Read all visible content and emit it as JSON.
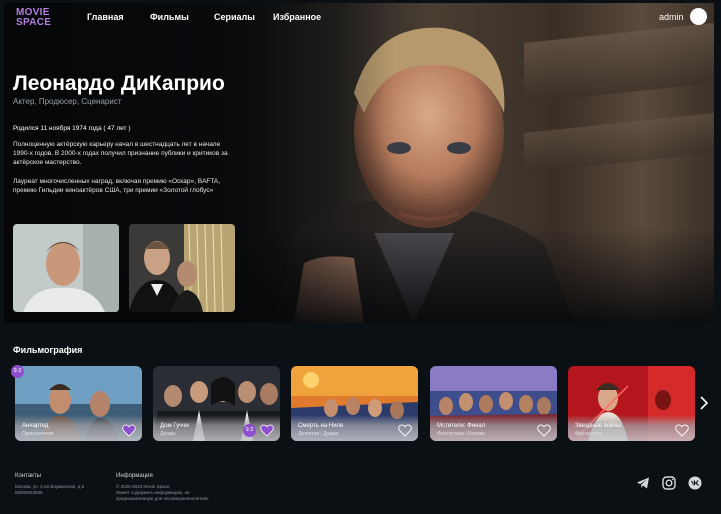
{
  "brand": {
    "logo_line1": "MOVIE",
    "logo_line2": "SPACE",
    "accent": "#b37fe0"
  },
  "nav": {
    "links": [
      "Главная",
      "Фильмы",
      "Сериалы",
      "Избранное"
    ],
    "user": "admin"
  },
  "person": {
    "name": "Леонардо ДиКаприо",
    "roles": "Актер, Продюсер, Сценарист",
    "born": "Родился 11 ноября 1974 года ( 47 лет )",
    "bio1": "Полноценную актёрскую карьеру начал в шестнадцать лет в начале 1990-х годов. В 2000-х годах получил признание публики и критиков за актёрское мастерство.",
    "bio2": "Лауреат многочисленных наград, включая премию «Оскар», BAFTA, премию Гильдии киноактёров США, три премии «Золотой глобус»"
  },
  "filmography": {
    "title": "Фильмография",
    "cards": [
      {
        "title": "Анчартед",
        "genre": "Приключения",
        "rating": "9.3",
        "favorite": true
      },
      {
        "title": "Дом Гуччи",
        "genre": "Драма",
        "rating": "9.3",
        "favorite": true
      },
      {
        "title": "Смерть на Ниле",
        "genre": "Детектив / Драма",
        "rating": "",
        "favorite": false
      },
      {
        "title": "Мстители: Финал",
        "genre": "Фантастика / Боевик",
        "rating": "",
        "favorite": false
      },
      {
        "title": "Звездные войны",
        "genre": "Фантастика",
        "rating": "",
        "favorite": false
      }
    ]
  },
  "footer": {
    "contacts_title": "Контакты",
    "contacts_line1": "Москва, ул. 2-ая Бауманская, д.5",
    "contacts_line2": "88005553535",
    "info_title": "Информация",
    "info_line1": "© 2020-2022 Movie Space.",
    "info_line2": "Может содержать информацию, не",
    "info_line3": "предназначенную для несовершеннолетних",
    "social_icons": [
      "telegram-icon",
      "instagram-icon",
      "vk-icon"
    ]
  }
}
